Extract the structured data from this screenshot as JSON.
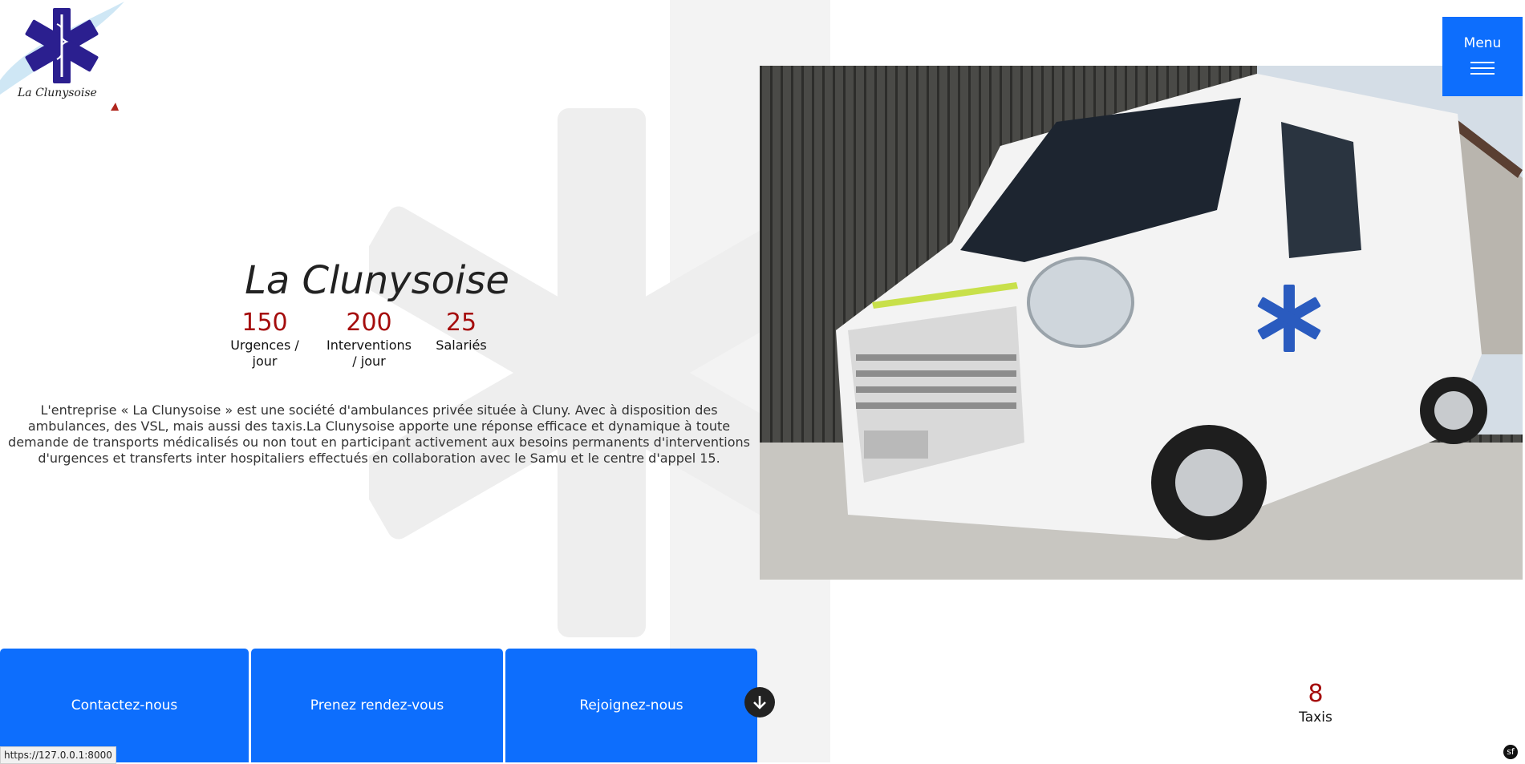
{
  "brand": {
    "logo_text": "La Clunysoise"
  },
  "menu": {
    "label": "Menu"
  },
  "hero": {
    "title": "La Clunysoise",
    "intro": "L'entreprise « La Clunysoise » est une société d'ambulances privée située à Cluny. Avec à disposition des ambulances, des VSL, mais aussi des taxis.La Clunysoise apporte une réponse efficace et dynamique à toute demande de transports médicalisés ou non tout en participant activement aux besoins permanents d'interventions d'urgences et transferts inter hospitaliers effectués en collaboration avec le Samu et le centre d'appel 15.",
    "photo_subject": "white ambulance van photo"
  },
  "stats": [
    {
      "value": "150",
      "label": "Urgences / jour"
    },
    {
      "value": "200",
      "label": "Interventions / jour"
    },
    {
      "value": "25",
      "label": "Salariés"
    }
  ],
  "taxi_stat": {
    "value": "8",
    "label": "Taxis"
  },
  "cta": [
    {
      "label": "Contactez-nous"
    },
    {
      "label": "Prenez rendez-vous"
    },
    {
      "label": "Rejoignez-nous"
    }
  ],
  "scroll_icon": "arrow-down-icon",
  "status_bar": {
    "url": "https://127.0.0.1:8000"
  },
  "colors": {
    "accent": "#0d6efd",
    "stat_number": "#a50d0d",
    "star_of_life": "#2b1f8f"
  }
}
